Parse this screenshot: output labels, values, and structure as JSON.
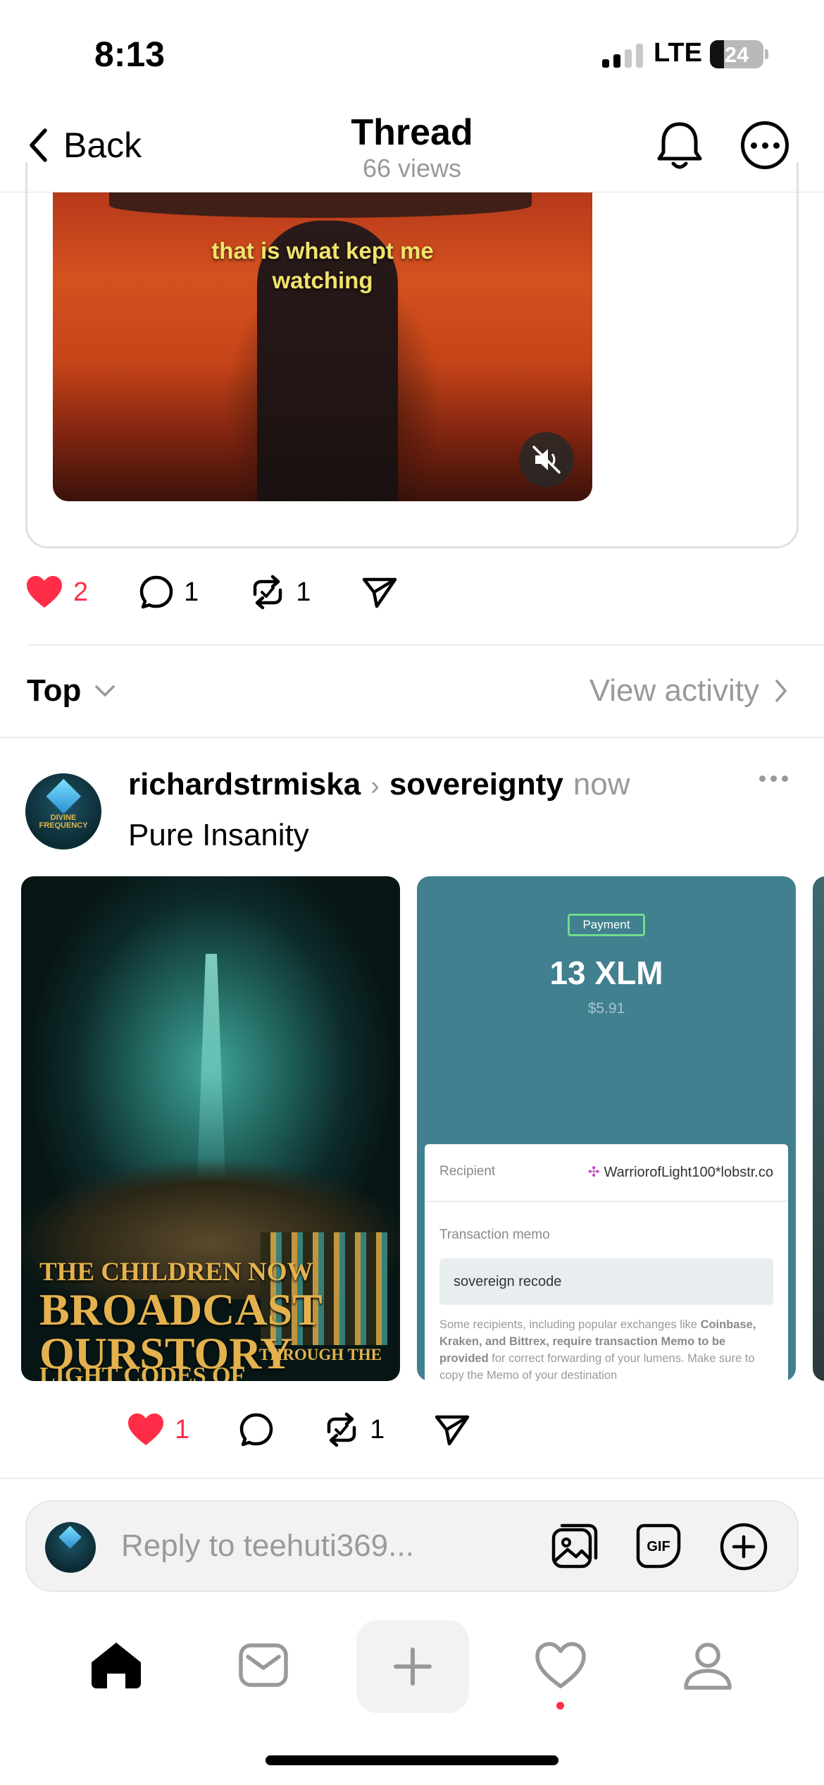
{
  "status_bar": {
    "time": "8:13",
    "network": "LTE",
    "battery": "24"
  },
  "header": {
    "back_label": "Back",
    "title": "Thread",
    "views": "66 views"
  },
  "quoted_video": {
    "caption_line1": "that is what kept me",
    "caption_line2": "watching"
  },
  "main_actions": {
    "likes": "2",
    "replies": "1",
    "reposts": "1"
  },
  "sort_bar": {
    "sort_label": "Top",
    "view_activity": "View activity"
  },
  "post": {
    "username": "richardstrmiska",
    "topic": "sovereignty",
    "timestamp": "now",
    "text": "Pure Insanity",
    "avatar_text": "DIVINE FREQUENCY",
    "image1": {
      "line1": "THE CHILDREN NOW",
      "line2": "BROADCAST",
      "line3": "OURSTORY",
      "line4": "THROUGH THE",
      "line5": "LIGHT CODES OF SOVEREIGNTY"
    },
    "image2": {
      "badge": "Payment",
      "amount": "13 XLM",
      "usd": "$5.91",
      "recipient_label": "Recipient",
      "recipient_value": "WarriorofLight100*lobstr.co",
      "memo_label": "Transaction memo",
      "memo_value": "sovereign recode",
      "note_part1": "Some recipients, including popular exchanges like ",
      "note_bold": "Coinbase, Kraken, and Bittrex, require transaction Memo to be provided",
      "note_part2": " for correct forwarding of your lumens. Make sure to copy the Memo of your destination"
    },
    "likes": "1",
    "reposts": "1"
  },
  "reply_bar": {
    "placeholder": "Reply to teehuti369..."
  },
  "colors": {
    "like_red": "#ff2d47",
    "muted_gray": "#999999",
    "payment_teal": "#41808f"
  }
}
